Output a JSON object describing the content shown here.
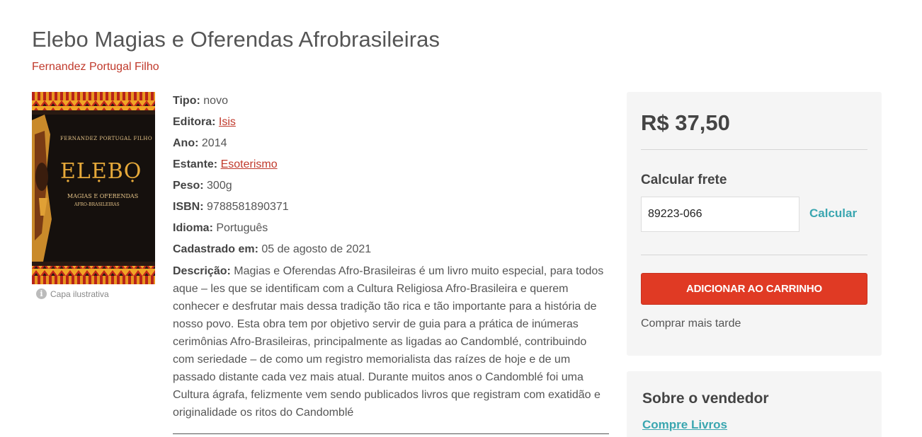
{
  "book": {
    "title": "Elebo Magias e Oferendas Afrobrasileiras",
    "author": "Fernandez Portugal Filho",
    "cover_caption": "Capa ilustrativa",
    "cover_text": {
      "author": "FERNANDEZ PORTUGAL FILHO",
      "title": "ẸLẸBỌ",
      "subtitle1": "MAGIAS E OFERENDAS",
      "subtitle2": "AFRO-BRASILEIRAS"
    }
  },
  "details": {
    "tipo_label": "Tipo:",
    "tipo": "novo",
    "editora_label": "Editora:",
    "editora": "Isis",
    "ano_label": "Ano:",
    "ano": "2014",
    "estante_label": "Estante:",
    "estante": "Esoterismo",
    "peso_label": "Peso:",
    "peso": "300g",
    "isbn_label": "ISBN:",
    "isbn": "9788581890371",
    "idioma_label": "Idioma:",
    "idioma": "Português",
    "cadastrado_label": "Cadastrado em:",
    "cadastrado": "05 de agosto de 2021",
    "descricao_label": "Descrição:",
    "descricao": "Magias e Oferendas Afro-Brasileiras é um livro muito especial, para todos aque – les que se identificam com a Cultura Religiosa Afro-Brasileira e querem conhecer e desfrutar mais dessa tradição tão rica e tão importante para a história de nosso povo. Esta obra tem por objetivo servir de guia para a prática de inúmeras cerimônias Afro-Brasileiras, principalmente as ligadas ao Candomblé, contribuindo com seriedade – de como um registro memorialista das raízes de hoje e de um passado distante cada vez mais atual. Durante muitos anos o Candomblé foi uma Cultura ágrafa, felizmente vem sendo publicados livros que registram com exatidão e originalidade os ritos do Candomblé"
  },
  "buybox": {
    "price": "R$ 37,50",
    "frete_label": "Calcular frete",
    "cep_value": "89223-066",
    "calcular_label": "Calcular",
    "cart_button": "ADICIONAR AO CARRINHO",
    "later_label": "Comprar mais tarde"
  },
  "seller": {
    "title": "Sobre o vendedor",
    "name": "Compre Livros"
  },
  "colors": {
    "author_link": "#c0392b",
    "accent_teal": "#3aa6b0",
    "cart_button": "#e03a24",
    "panel_bg": "#f5f5f5"
  }
}
